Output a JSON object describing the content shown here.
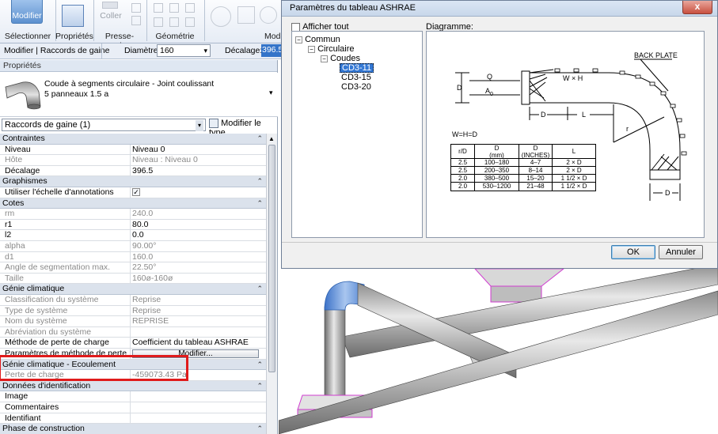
{
  "ribbon": {
    "modifier": "Modifier",
    "select": "Sélectionner",
    "properties": "Propriétés",
    "clipboard": "Presse-papiers",
    "cut": "Coller",
    "geometry": "Géométrie",
    "modify_truncated": "Mod"
  },
  "options_bar": {
    "context": "Modifier | Raccords de gaine",
    "diameter_label": "Diamètre:",
    "diameter_value": "160",
    "offset_label": "Décalage:",
    "offset_value": "396.5"
  },
  "palette": {
    "title": "Propriétés",
    "type_name": "Coude à segments circulaire - Joint coulissant",
    "type_sub": "5 panneaux 1.5 a",
    "filter": "Raccords de gaine (1)",
    "edit_type": "Modifier le type"
  },
  "groups": {
    "contraintes": "Contraintes",
    "graphismes": "Graphismes",
    "cotes": "Cotes",
    "genie": "Génie climatique",
    "ecoulement": "Génie climatique - Ecoulement",
    "identification": "Données d'identification",
    "phase": "Phase de construction"
  },
  "rows": {
    "niveau_k": "Niveau",
    "niveau_v": "Niveau 0",
    "hote_k": "Hôte",
    "hote_v": "Niveau : Niveau 0",
    "decalage_k": "Décalage",
    "decalage_v": "396.5",
    "echelle_k": "Utiliser l'échelle d'annotations",
    "rm_k": "rm",
    "rm_v": "240.0",
    "r1_k": "r1",
    "r1_v": "80.0",
    "l2_k": "l2",
    "l2_v": "0.0",
    "alpha_k": "alpha",
    "alpha_v": "90.00°",
    "d1_k": "d1",
    "d1_v": "160.0",
    "angle_k": "Angle de segmentation max.",
    "angle_v": "22.50°",
    "taille_k": "Taille",
    "taille_v": "160ø-160ø",
    "classif_k": "Classification du système",
    "classif_v": "Reprise",
    "type_sys_k": "Type de système",
    "type_sys_v": "Reprise",
    "nom_sys_k": "Nom du système",
    "nom_sys_v": "REPRISE",
    "abrev_k": "Abréviation du système",
    "abrev_v": "",
    "methode_k": "Méthode de perte de charge",
    "methode_v": "Coefficient du tableau ASHRAE",
    "param_k": "Paramètres de méthode de perte de c...",
    "param_v": "Modifier...",
    "perte_k": "Perte de charge",
    "perte_v": "-459073.43 Pa",
    "image_k": "Image",
    "comment_k": "Commentaires",
    "ident_k": "Identifiant"
  },
  "dialog": {
    "title": "Paramètres du tableau ASHRAE",
    "close": "x",
    "show_all": "Afficher tout",
    "diagram_label": "Diagramme:",
    "tree": [
      "Commun",
      "Circulaire",
      "Coudes",
      "CD3-11",
      "CD3-15",
      "CD3-20"
    ],
    "ok": "OK",
    "cancel": "Annuler"
  },
  "diagram": {
    "back_plate": "BACK PLATE",
    "w_h": "W × H",
    "q": "Q",
    "a0": "A",
    "a0_sub": "0",
    "d": "D",
    "l": "L",
    "r": "r",
    "whd": "W=H=D",
    "table": {
      "headers": [
        "r/D",
        "D\n(mm)",
        "D\n(INCHES)",
        "L"
      ],
      "rows": [
        [
          "2.5",
          "100–180",
          "4–7",
          "2 × D"
        ],
        [
          "2.5",
          "200–350",
          "8–14",
          "2 × D"
        ],
        [
          "2.0",
          "380–500",
          "15–20",
          "1 1/2 × D"
        ],
        [
          "2.0",
          "530–1200",
          "21–48",
          "1 1/2 × D"
        ]
      ]
    }
  }
}
